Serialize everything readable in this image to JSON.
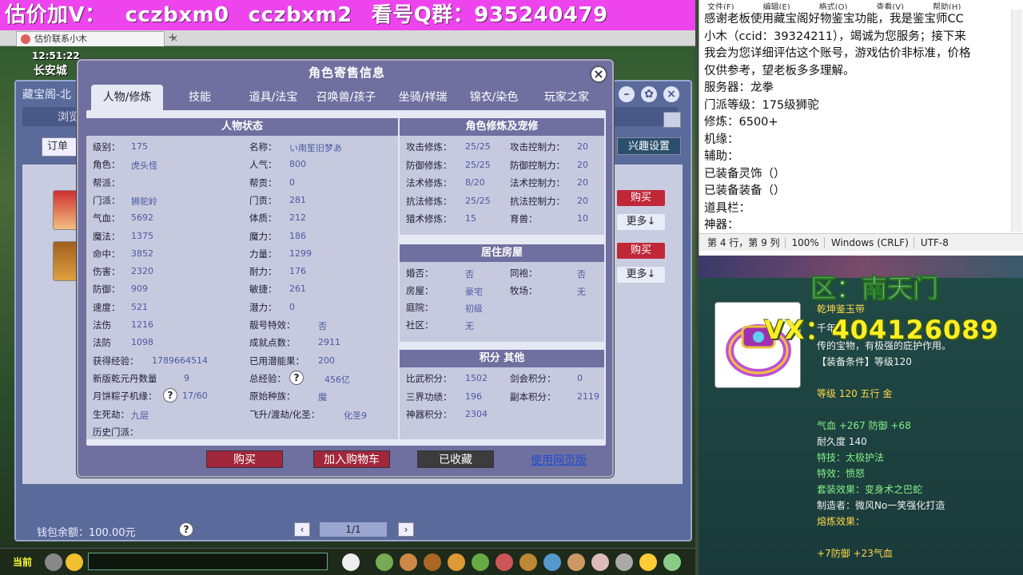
{
  "banner": {
    "parts": [
      "估价加V：",
      "cczbxm0",
      "cczbxm2",
      "看号Q群：935240479"
    ]
  },
  "browser": {
    "tab_title": "估价联系小木",
    "tab_close": "×",
    "tab_add": "+"
  },
  "game": {
    "clock": "12:51:22",
    "city": "长安城",
    "shop_title": "藏宝阁-北",
    "browse": "浏览",
    "order_label": "订单",
    "interest_button": "兴趣设置",
    "buy_label": "购买",
    "more_label": "更多↓",
    "wallet": "钱包余额：100.00元",
    "pager": "1/1",
    "help": "?",
    "current_label": "当前"
  },
  "dialog": {
    "title": "角色寄售信息",
    "close": "×",
    "tabs": [
      "人物/修炼",
      "技能",
      "道具/法宝",
      "召唤兽/孩子",
      "坐骑/祥瑞",
      "锦衣/染色",
      "玩家之家"
    ],
    "status_head": "人物状态",
    "cultivation_head": "角色修炼及宠修",
    "house_head": "居住房屋",
    "points_head": "积分 其他",
    "left_col": [
      {
        "label": "级别：",
        "value": "175"
      },
      {
        "label": "角色：",
        "value": "虎头怪"
      },
      {
        "label": "帮派：",
        "value": ""
      },
      {
        "label": "门派：",
        "value": "狮驼岭"
      },
      {
        "label": "气血：",
        "value": "5692"
      },
      {
        "label": "魔法：",
        "value": "1375"
      },
      {
        "label": "命中：",
        "value": "3852"
      },
      {
        "label": "伤害：",
        "value": "2320"
      },
      {
        "label": "防御：",
        "value": "909"
      },
      {
        "label": "速度：",
        "value": "521"
      },
      {
        "label": "法伤",
        "value": "1216"
      },
      {
        "label": "法防",
        "value": "1098"
      },
      {
        "label": "获得经验：",
        "value": "1789664514"
      },
      {
        "label": "新版乾元丹数量",
        "value": "9"
      },
      {
        "label": "月饼粽子机缘：",
        "value": "17/60"
      },
      {
        "label": "生死劫：",
        "value": "九层"
      },
      {
        "label": "历史门派：",
        "value": ""
      }
    ],
    "mid_col": [
      {
        "label": "名称：",
        "value": "い南笙旧梦あ"
      },
      {
        "label": "人气：",
        "value": "800"
      },
      {
        "label": "帮贡：",
        "value": "0"
      },
      {
        "label": "门贡：",
        "value": "281"
      },
      {
        "label": "体质：",
        "value": "212"
      },
      {
        "label": "魔力：",
        "value": "186"
      },
      {
        "label": "力量：",
        "value": "1299"
      },
      {
        "label": "耐力：",
        "value": "176"
      },
      {
        "label": "敏捷：",
        "value": "261"
      },
      {
        "label": "潜力：",
        "value": "0"
      },
      {
        "label": "靓号特效：",
        "value": "否"
      },
      {
        "label": "成就点数：",
        "value": "2911"
      },
      {
        "label": "已用潜能果：",
        "value": "200"
      },
      {
        "label": "总经验：",
        "value": "456亿"
      },
      {
        "label": "原始种族：",
        "value": "魔"
      },
      {
        "label": "飞升/渡劫/化圣：",
        "value": "化圣9"
      }
    ],
    "cult_rows": [
      {
        "l1": "攻击修炼：",
        "v1": "25/25",
        "l2": "攻击控制力：",
        "v2": "20"
      },
      {
        "l1": "防御修炼：",
        "v1": "25/25",
        "l2": "防御控制力：",
        "v2": "20"
      },
      {
        "l1": "法术修炼：",
        "v1": "8/20",
        "l2": "法术控制力：",
        "v2": "20"
      },
      {
        "l1": "抗法修炼：",
        "v1": "25/25",
        "l2": "抗法控制力：",
        "v2": "20"
      },
      {
        "l1": "猎术修炼：",
        "v1": "15",
        "l2": "育兽：",
        "v2": "10"
      }
    ],
    "house_rows": [
      {
        "l1": "婚否：",
        "v1": "否",
        "l2": "同袍：",
        "v2": "否"
      },
      {
        "l1": "房屋：",
        "v1": "豪宅",
        "l2": "牧场：",
        "v2": "无"
      },
      {
        "l1": "庭院：",
        "v1": "初级",
        "l2": "",
        "v2": ""
      },
      {
        "l1": "社区：",
        "v1": "无",
        "l2": "",
        "v2": ""
      }
    ],
    "points_rows": [
      {
        "l1": "比武积分：",
        "v1": "1502",
        "l2": "剑会积分：",
        "v2": "0"
      },
      {
        "l1": "三界功绩：",
        "v1": "196",
        "l2": "副本积分：",
        "v2": "2119"
      },
      {
        "l1": "神器积分：",
        "v1": "2304",
        "l2": "",
        "v2": ""
      }
    ],
    "buttons": {
      "buy": "购买",
      "cart": "加入购物车",
      "fav": "已收藏",
      "web": "使用网页版"
    }
  },
  "notepad": {
    "menu": [
      "文件(F)",
      "编辑(E)",
      "格式(O)",
      "查看(V)",
      "帮助(H)"
    ],
    "lines": [
      "感谢老板使用藏宝阁好物鉴宝功能，我是鉴宝师CC",
      "小木（ccid：39324211），竭诚为您服务；接下来",
      "我会为您详细评估这个账号，游戏估价非标准，价格",
      "仅供参考，望老板多多理解。",
      "服务器：龙拳",
      "门派等级：175级狮驼",
      "修炼：6500+",
      "机缘：",
      "辅助：",
      "已装备灵饰（）",
      "已装备装备（）",
      "道具栏：",
      "神器："
    ],
    "status": [
      "第 4 行，第 9 列",
      "100%",
      "Windows (CRLF)",
      "UTF-8"
    ]
  },
  "overlay": {
    "area": "区：南天门",
    "vx": "VX：404126089"
  },
  "item": {
    "lines": [
      {
        "text": "乾坤鉴玉带",
        "cls": "y"
      },
      {
        "text": "千年",
        "cls": "w"
      },
      {
        "text": "传的宝物，有极强的庇护作用。",
        "cls": "w"
      },
      {
        "text": "【装备条件】等级120",
        "cls": "w"
      },
      {
        "text": "等级 120 五行 金",
        "cls": "y"
      },
      {
        "text": "气血 +267 防御 +68",
        "cls": "g"
      },
      {
        "text": "耐久度 140",
        "cls": "w"
      },
      {
        "text": "特技：太极护法",
        "cls": "g"
      },
      {
        "text": "特效：愤怒",
        "cls": "g"
      },
      {
        "text": "套装效果：变身术之巴蛇",
        "cls": "g"
      },
      {
        "text": "制造者：微风No一笑强化打造",
        "cls": "w"
      },
      {
        "text": "熔炼效果：",
        "cls": "y"
      },
      {
        "text": "+7防御 +23气血",
        "cls": "y"
      }
    ]
  },
  "colors": {
    "banner": "#ee44ee",
    "dialog": "#6f6fa0",
    "buy": "#a0283a",
    "link": "#1e4ed0"
  }
}
